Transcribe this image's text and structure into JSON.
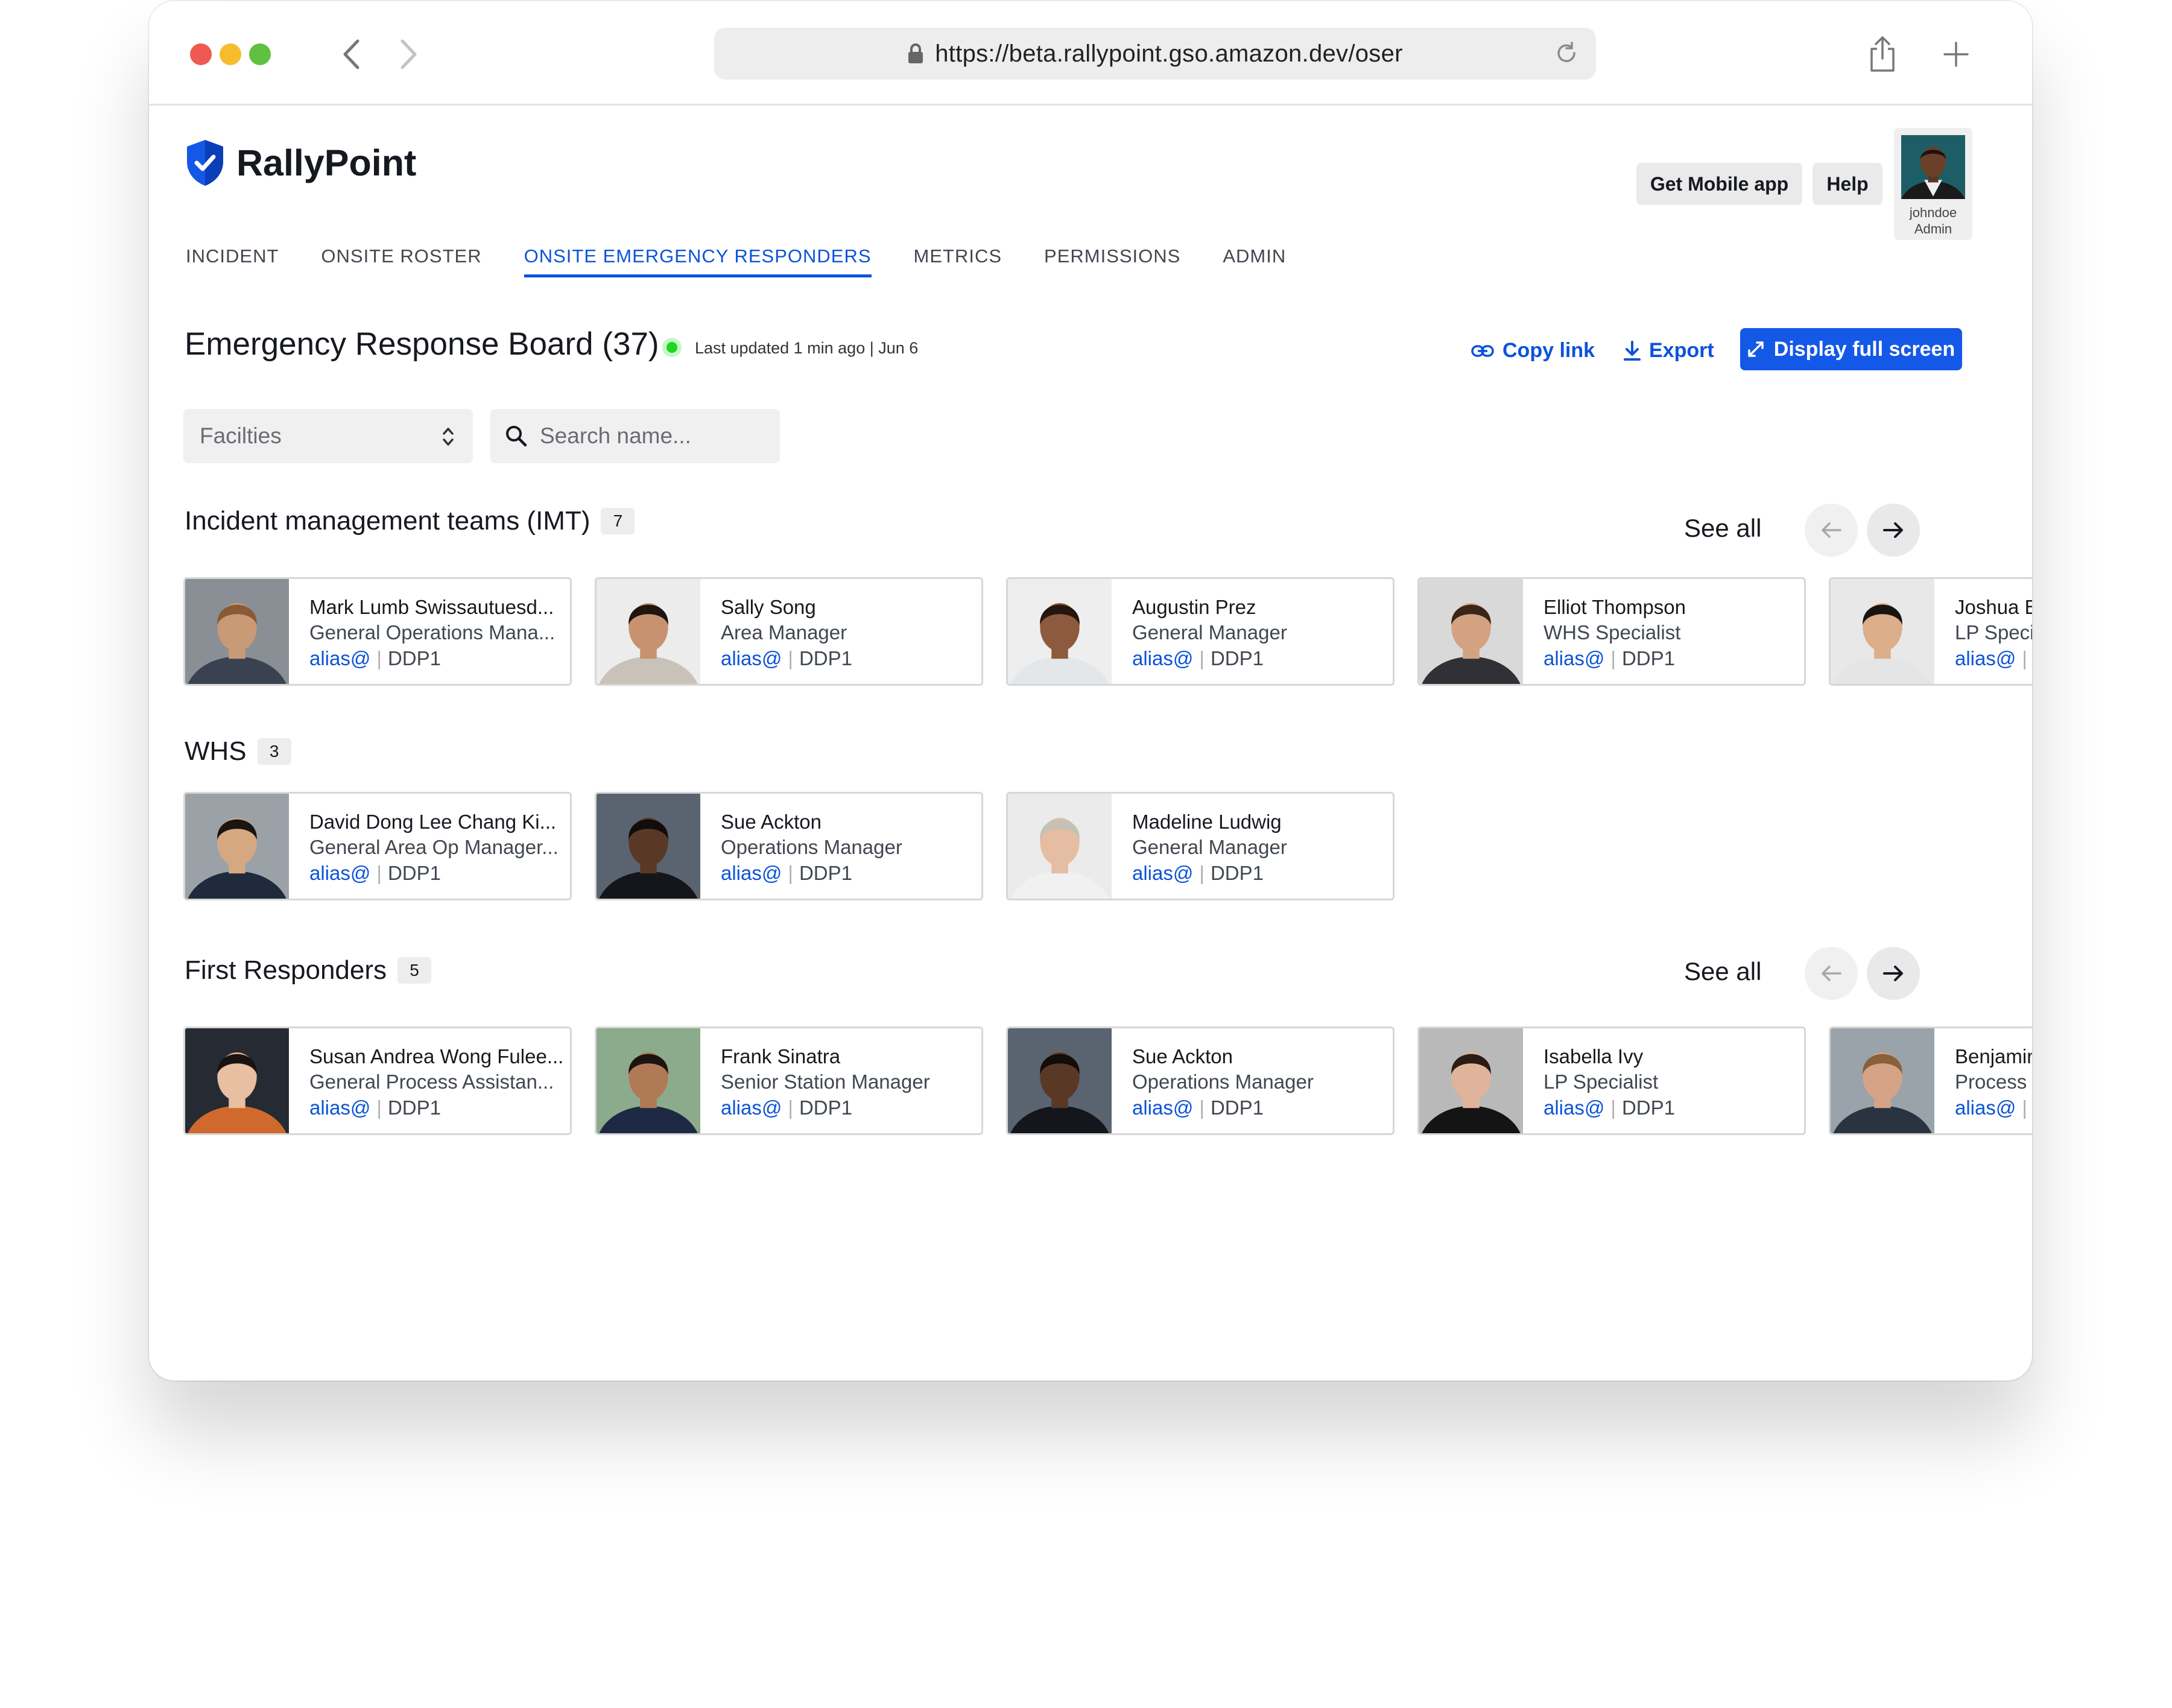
{
  "browser": {
    "url": "https://beta.rallypoint.gso.amazon.dev/oser"
  },
  "app": {
    "name": "RallyPoint"
  },
  "header": {
    "mobile_app_label": "Get Mobile app",
    "help_label": "Help",
    "user": {
      "name": "johndoe",
      "role": "Admin"
    }
  },
  "tabs": [
    {
      "label": "INCIDENT",
      "active": false
    },
    {
      "label": "ONSITE ROSTER",
      "active": false
    },
    {
      "label": "ONSITE EMERGENCY RESPONDERS",
      "active": true
    },
    {
      "label": "METRICS",
      "active": false
    },
    {
      "label": "PERMISSIONS",
      "active": false
    },
    {
      "label": "ADMIN",
      "active": false
    }
  ],
  "board": {
    "title": "Emergency Response Board (37)",
    "updated": "Last updated 1 min ago | Jun 6",
    "copy_link_label": "Copy link",
    "export_label": "Export",
    "fullscreen_label": "Display full screen"
  },
  "filters": {
    "facilities_label": "Facilties",
    "search_placeholder": "Search name..."
  },
  "sections": [
    {
      "title": "Incident management teams (IMT)",
      "count": "7",
      "see_all": "See all",
      "people": [
        {
          "name": "Mark Lumb Swissautuesd...",
          "role": "General Operations Mana...",
          "alias": "alias@",
          "site": "DDP1",
          "skin": "#c99a76",
          "hair": "#8a5a34",
          "bg": "#8a8f96",
          "shirt": "#3a4150"
        },
        {
          "name": "Sally Song",
          "role": "Area Manager",
          "alias": "alias@",
          "site": "DDP1",
          "skin": "#c89270",
          "hair": "#1e1410",
          "bg": "#ececec",
          "shirt": "#c8c2b9"
        },
        {
          "name": "Augustin Prez",
          "role": "General Manager",
          "alias": "alias@",
          "site": "DDP1",
          "skin": "#8c5a3c",
          "hair": "#241510",
          "bg": "#eeeeee",
          "shirt": "#e4e7ea"
        },
        {
          "name": "Elliot Thompson",
          "role": "WHS Specialist",
          "alias": "alias@",
          "site": "DDP1",
          "skin": "#d3a282",
          "hair": "#3a2618",
          "bg": "#d9d9d9",
          "shirt": "#2f3136"
        },
        {
          "name": "Joshua B",
          "role": "LP Speci",
          "alias": "alias@",
          "site": "",
          "skin": "#dcae8a",
          "hair": "#1a1410",
          "bg": "#e8e8e8",
          "shirt": "#e5e5e5"
        }
      ]
    },
    {
      "title": "WHS",
      "count": "3",
      "see_all": "",
      "people": [
        {
          "name": "David Dong Lee Chang Ki...",
          "role": "General Area Op Manager...",
          "alias": "alias@",
          "site": "DDP1",
          "skin": "#d6a882",
          "hair": "#1b1410",
          "bg": "#9aa2a8",
          "shirt": "#1f2a3c"
        },
        {
          "name": "Sue Ackton",
          "role": "Operations Manager",
          "alias": "alias@",
          "site": "DDP1",
          "skin": "#5a3826",
          "hair": "#120c0a",
          "bg": "#5a6470",
          "shirt": "#14161c"
        },
        {
          "name": "Madeline Ludwig",
          "role": "General Manager",
          "alias": "alias@",
          "site": "DDP1",
          "skin": "#e4bda2",
          "hair": "#c6c0b6",
          "bg": "#ebebeb",
          "shirt": "#f1f1f1"
        }
      ]
    },
    {
      "title": "First Responders",
      "count": "5",
      "see_all": "See all",
      "people": [
        {
          "name": "Susan Andrea Wong Fulee...",
          "role": "General Process Assistan...",
          "alias": "alias@",
          "site": "DDP1",
          "skin": "#e8bfa0",
          "hair": "#1a1210",
          "bg": "#262b33",
          "shirt": "#d06a2c"
        },
        {
          "name": "Frank Sinatra",
          "role": "Senior Station Manager",
          "alias": "alias@",
          "site": "DDP1",
          "skin": "#b07a56",
          "hair": "#1c1410",
          "bg": "#8cab8c",
          "shirt": "#1e2a44"
        },
        {
          "name": "Sue Ackton",
          "role": "Operations Manager",
          "alias": "alias@",
          "site": "DDP1",
          "skin": "#5a3826",
          "hair": "#120c0a",
          "bg": "#5a6470",
          "shirt": "#14161c"
        },
        {
          "name": "Isabella Ivy",
          "role": "LP Specialist",
          "alias": "alias@",
          "site": "DDP1",
          "skin": "#e0b49a",
          "hair": "#2a1c14",
          "bg": "#b9b9b9",
          "shirt": "#141414"
        },
        {
          "name": "Benjamin",
          "role": "Process",
          "alias": "alias@",
          "site": "",
          "skin": "#d5a486",
          "hair": "#8a5f3c",
          "bg": "#9aa3aa",
          "shirt": "#2a3340"
        }
      ]
    }
  ],
  "colors": {
    "accent": "#0b53d9",
    "primary_button": "#1458e8",
    "live_status": "#1ed81e"
  },
  "icons": [
    "lock-icon",
    "reload-icon",
    "share-icon",
    "plus-icon",
    "shield-check-icon",
    "link-icon",
    "download-icon",
    "expand-icon",
    "search-icon",
    "chevron-updown-icon",
    "arrow-left-icon",
    "arrow-right-icon"
  ]
}
